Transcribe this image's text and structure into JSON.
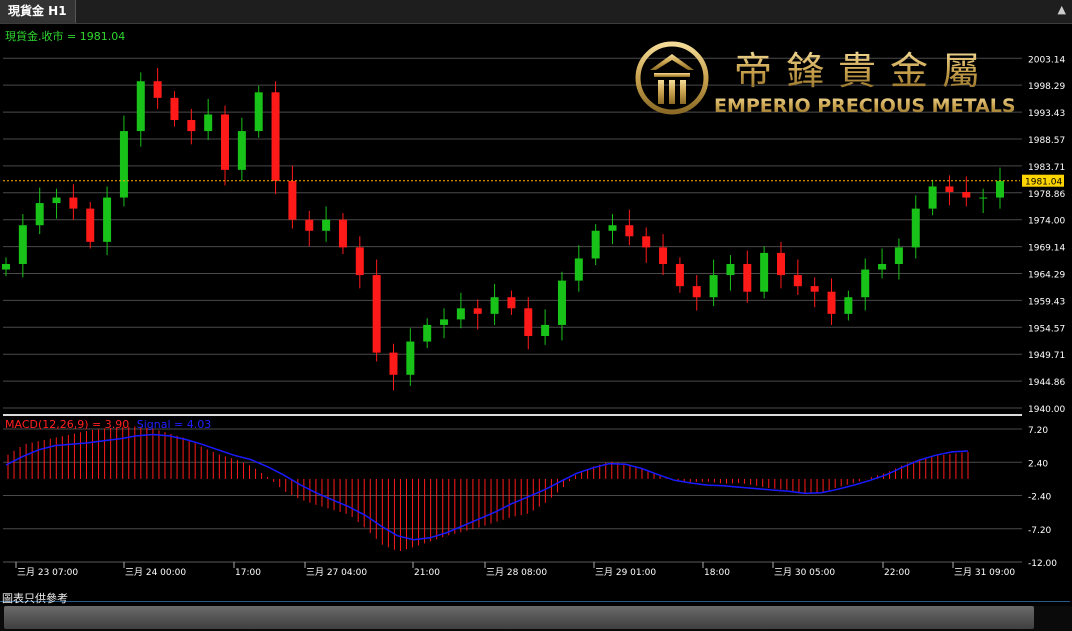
{
  "tab": {
    "title": "現貨金 H1"
  },
  "price_panel": {
    "label": "現貨金.收市 = 1981.04",
    "current_price": 1981.04,
    "current_price_label": "1981.04",
    "right_axis_ticks": [
      "2003.14",
      "1998.29",
      "1993.43",
      "1988.57",
      "1983.71",
      "1978.86",
      "1974.00",
      "1969.14",
      "1964.29",
      "1959.43",
      "1954.57",
      "1949.71",
      "1944.86",
      "1940.00"
    ]
  },
  "logo": {
    "chinese": "帝鋒貴金屬",
    "english": "EMPERIO PRECIOUS METALS"
  },
  "macd_panel": {
    "label_macd": "MACD(12,26,9) = 3.90",
    "label_signal": "Signal = 4.03",
    "right_axis_ticks": [
      "7.20",
      "2.40",
      "-2.40",
      "-7.20",
      "-12.00"
    ]
  },
  "time_axis": {
    "labels": [
      "三月 23 07:00",
      "三月 24 00:00",
      "17:00",
      "三月 27 04:00",
      "21:00",
      "三月 28 08:00",
      "三月 29 01:00",
      "18:00",
      "三月 30 05:00",
      "22:00",
      "三月 31 09:00"
    ]
  },
  "footer": {
    "note": "圖表只供參考"
  },
  "colors": {
    "up": "#19c219",
    "down": "#ff1a1a",
    "signal": "#1a1aff",
    "price_line": "#ffb000",
    "grid": "#4a4a4a",
    "text_green": "#2fd62f"
  },
  "chart_data": [
    {
      "type": "candlestick",
      "title": "現貨金 H1",
      "ylim": [
        1940.0,
        2005.0
      ],
      "x": [
        "三月 23 07:00",
        "三月 24 00:00",
        "17:00",
        "三月 27 04:00",
        "21:00",
        "三月 28 08:00",
        "三月 29 01:00",
        "18:00",
        "三月 30 05:00",
        "22:00",
        "三月 31 09:00"
      ],
      "close": [
        1966,
        1973,
        1977,
        1978,
        1976,
        1970,
        1978,
        1990,
        1999,
        1996,
        1992,
        1990,
        1993,
        1983,
        1990,
        1997,
        1981,
        1974,
        1972,
        1974,
        1969,
        1964,
        1950,
        1946,
        1952,
        1955,
        1956,
        1958,
        1957,
        1960,
        1958,
        1953,
        1955,
        1963,
        1967,
        1972,
        1973,
        1971,
        1969,
        1966,
        1962,
        1960,
        1964,
        1966,
        1961,
        1968,
        1964,
        1962,
        1961,
        1957,
        1960,
        1965,
        1966,
        1969,
        1976,
        1980,
        1979,
        1978,
        1978,
        1981
      ],
      "current": 1981.04
    },
    {
      "type": "bar",
      "title": "MACD(12,26,9)",
      "macd_value": 3.9,
      "signal_value": 4.03,
      "ylim": [
        -12.0,
        8.5
      ],
      "macd": [
        3.5,
        5.0,
        5.5,
        6.0,
        6.5,
        7.0,
        7.3,
        7.5,
        7.6,
        7.2,
        6.5,
        5.8,
        4.5,
        3.5,
        2.8,
        1.8,
        0.2,
        -1.8,
        -3.0,
        -3.8,
        -4.5,
        -5.2,
        -7.2,
        -9.5,
        -10.5,
        -9.8,
        -9.0,
        -8.2,
        -7.6,
        -7.0,
        -6.2,
        -5.5,
        -5.0,
        -3.5,
        -1.5,
        0.8,
        1.8,
        2.5,
        2.2,
        1.5,
        0.5,
        -0.3,
        -0.5,
        -0.4,
        -0.7,
        -0.6,
        -1.0,
        -1.4,
        -1.6,
        -2.2,
        -2.0,
        -1.2,
        -0.6,
        0.2,
        0.9,
        2.0,
        2.8,
        3.3,
        3.6,
        3.9
      ],
      "signal": [
        2.0,
        3.2,
        4.2,
        4.8,
        5.0,
        5.2,
        5.5,
        5.8,
        6.2,
        6.4,
        6.2,
        5.7,
        5.0,
        4.2,
        3.4,
        2.8,
        1.8,
        0.6,
        -0.8,
        -2.0,
        -3.0,
        -4.0,
        -5.2,
        -6.8,
        -8.2,
        -8.8,
        -8.5,
        -7.8,
        -6.8,
        -5.8,
        -4.8,
        -3.6,
        -2.6,
        -1.6,
        -0.4,
        0.8,
        1.6,
        2.2,
        2.1,
        1.5,
        0.6,
        -0.2,
        -0.6,
        -0.9,
        -1.0,
        -1.2,
        -1.4,
        -1.6,
        -1.8,
        -2.1,
        -2.0,
        -1.5,
        -0.9,
        -0.2,
        0.6,
        1.7,
        2.7,
        3.4,
        3.9,
        4.03
      ]
    }
  ]
}
